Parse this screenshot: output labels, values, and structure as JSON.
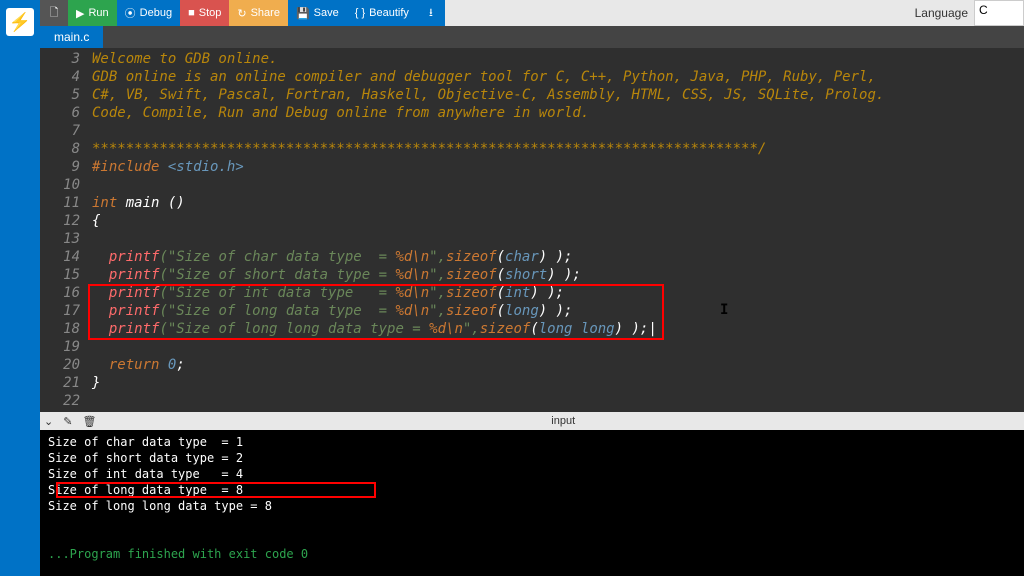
{
  "toolbar": {
    "run": "Run",
    "debug": "Debug",
    "stop": "Stop",
    "share": "Share",
    "save": "Save",
    "beautify": "Beautify",
    "language_label": "Language",
    "language_value": "C"
  },
  "tab": {
    "name": "main.c"
  },
  "gutter": {
    "start": 3,
    "end": 22
  },
  "code": {
    "l3": "Welcome to GDB online.",
    "l4": "GDB online is an online compiler and debugger tool for C, C++, Python, Java, PHP, Ruby, Perl,",
    "l5": "C#, VB, Swift, Pascal, Fortran, Haskell, Objective-C, Assembly, HTML, CSS, JS, SQLite, Prolog.",
    "l6": "Code, Compile, Run and Debug online from anywhere in world.",
    "l8": "*******************************************************************************/",
    "l9a": "#include ",
    "l9b": "<stdio.h>",
    "l11a": "int",
    "l11b": " main ()",
    "l12": "{",
    "p14a": "printf",
    "p14s1": "(\"Size of char data type  = ",
    "p14f": "%d\\n",
    "p14s2": "\",",
    "p14z": "sizeof",
    "p14p": "(",
    "p14t": "char",
    "p14e": ") );",
    "p15a": "printf",
    "p15s1": "(\"Size of short data type = ",
    "p15f": "%d\\n",
    "p15s2": "\",",
    "p15z": "sizeof",
    "p15p": "(",
    "p15t": "short",
    "p15e": ") );",
    "p16a": "printf",
    "p16s1": "(\"Size of int data type   = ",
    "p16f": "%d\\n",
    "p16s2": "\",",
    "p16z": "sizeof",
    "p16p": "(",
    "p16t": "int",
    "p16e": ") );",
    "p17a": "printf",
    "p17s1": "(\"Size of long data type  = ",
    "p17f": "%d\\n",
    "p17s2": "\",",
    "p17z": "sizeof",
    "p17p": "(",
    "p17t": "long",
    "p17e": ") );",
    "p18a": "printf",
    "p18s1": "(\"Size of long long data type = ",
    "p18f": "%d\\n",
    "p18s2": "\",",
    "p18z": "sizeof",
    "p18p": "(",
    "p18t": "long long",
    "p18e": ") );|",
    "l20a": "return ",
    "l20b": "0",
    "l20c": ";",
    "l21": "}"
  },
  "output": {
    "tab": "input",
    "l1": "Size of char data type  = 1",
    "l2": "Size of short data type = 2",
    "l3": "Size of int data type   = 4",
    "l4": "Size of long data type  = 8",
    "l5": "Size of long long data type = 8",
    "exit": "...Program finished with exit code 0"
  },
  "glyph": {
    "new": "🗋",
    "run": "▶",
    "debug": "⦿",
    "stop": "■",
    "share": "↻",
    "save": "💾",
    "beautify": "{ }",
    "download": "⭳",
    "chevdown": "⌄",
    "pencil": "✎",
    "trash": "🗑",
    "logo": "⚡"
  }
}
